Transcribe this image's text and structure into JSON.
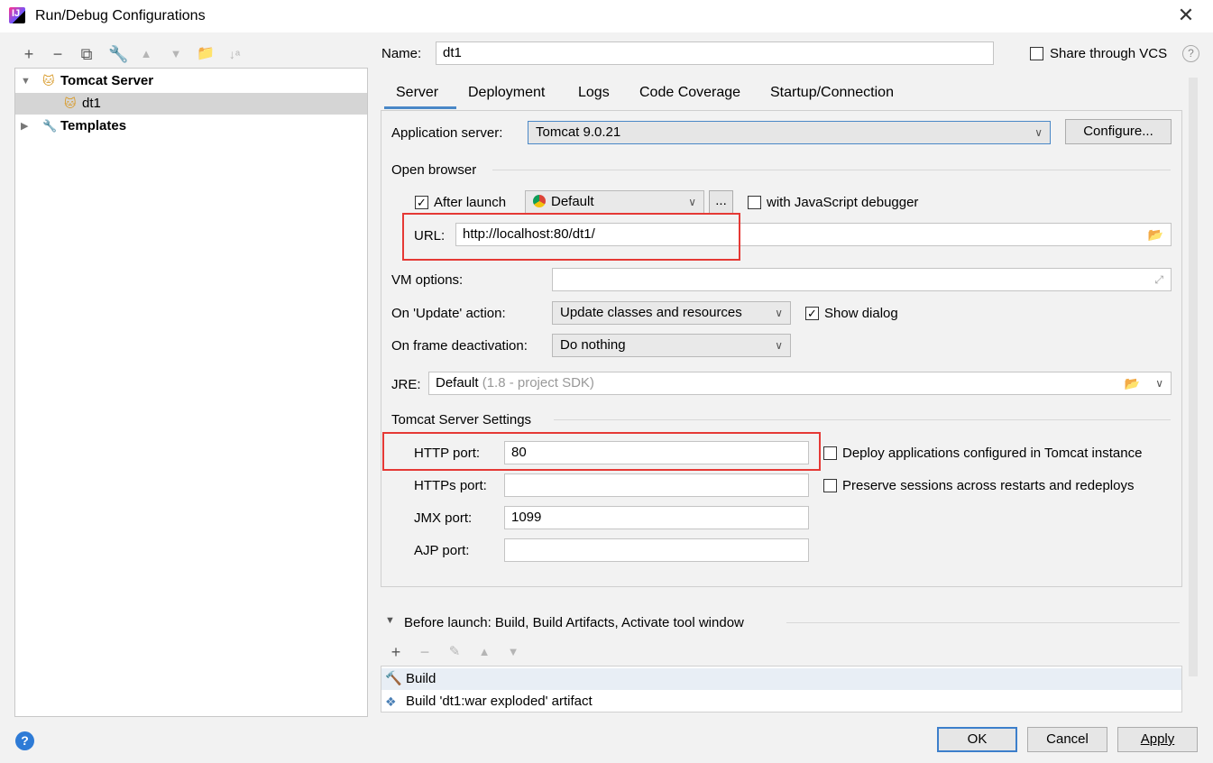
{
  "window": {
    "title": "Run/Debug Configurations"
  },
  "tree": {
    "tomcat_group": "Tomcat Server",
    "dt1": "dt1",
    "templates": "Templates"
  },
  "header": {
    "name_label": "Name:",
    "name_value": "dt1",
    "share_label": "Share through VCS"
  },
  "tabs": [
    "Server",
    "Deployment",
    "Logs",
    "Code Coverage",
    "Startup/Connection"
  ],
  "server": {
    "app_server_label": "Application server:",
    "app_server_value": "Tomcat 9.0.21",
    "configure_label": "Configure...",
    "open_browser_label": "Open browser",
    "after_launch_label": "After launch",
    "after_launch_checked": true,
    "browser_value": "Default",
    "ellipsis_label": "...",
    "js_debugger_label": "with JavaScript debugger",
    "url_label": "URL:",
    "url_value": "http://localhost:80/dt1/",
    "vm_options_label": "VM options:",
    "vm_options_value": "",
    "on_update_label": "On 'Update' action:",
    "on_update_value": "Update classes and resources",
    "show_dialog_label": "Show dialog",
    "show_dialog_checked": true,
    "on_frame_label": "On frame deactivation:",
    "on_frame_value": "Do nothing",
    "jre_label": "JRE:",
    "jre_value": "Default",
    "jre_hint": "(1.8 - project SDK)",
    "tomcat_settings_label": "Tomcat Server Settings",
    "http_port_label": "HTTP port:",
    "http_port_value": "80",
    "https_port_label": "HTTPs port:",
    "https_port_value": "",
    "jmx_port_label": "JMX port:",
    "jmx_port_value": "1099",
    "ajp_port_label": "AJP port:",
    "ajp_port_value": "",
    "deploy_apps_label": "Deploy applications configured in Tomcat instance",
    "preserve_sessions_label": "Preserve sessions across restarts and redeploys"
  },
  "before_launch": {
    "title": "Before launch: Build, Build Artifacts, Activate tool window",
    "items": [
      "Build",
      "Build 'dt1:war exploded' artifact"
    ]
  },
  "footer": {
    "ok": "OK",
    "cancel": "Cancel",
    "apply": "Apply"
  },
  "colors": {
    "highlight_box": "#e53935",
    "accent": "#4a88c7"
  }
}
